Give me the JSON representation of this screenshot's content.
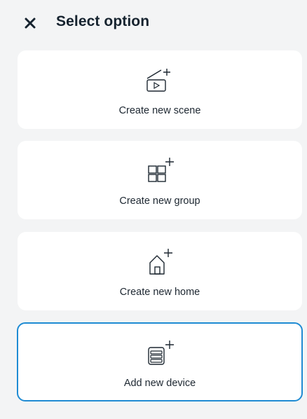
{
  "header": {
    "title": "Select option",
    "close_icon": "close-icon"
  },
  "options": [
    {
      "label": "Create new scene",
      "icon": "scene-add-icon",
      "selected": false
    },
    {
      "label": "Create new group",
      "icon": "group-add-icon",
      "selected": false
    },
    {
      "label": "Create new home",
      "icon": "home-add-icon",
      "selected": false
    },
    {
      "label": "Add new device",
      "icon": "device-add-icon",
      "selected": true
    }
  ],
  "colors": {
    "background": "#f3f4f5",
    "card": "#ffffff",
    "selected_border": "#1e8bd3",
    "text": "#16232f"
  }
}
